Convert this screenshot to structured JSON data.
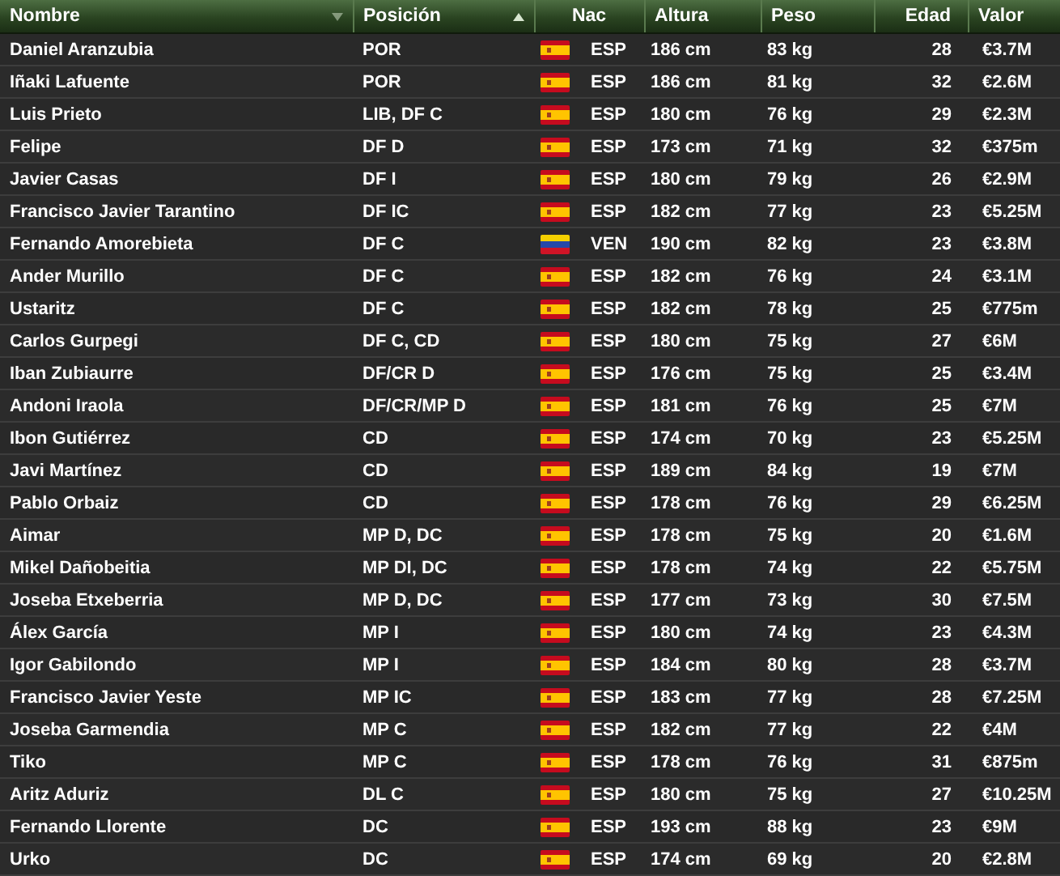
{
  "table": {
    "columns": [
      {
        "label": "Nombre",
        "sort_ascending": false,
        "sort_descending": true
      },
      {
        "label": "Posición",
        "sort_ascending": true,
        "sort_descending": false
      },
      {
        "label": "Nac",
        "sort_ascending": false,
        "sort_descending": false
      },
      {
        "label": "Altura",
        "sort_ascending": false,
        "sort_descending": false
      },
      {
        "label": "Peso",
        "sort_ascending": false,
        "sort_descending": false
      },
      {
        "label": "Edad",
        "sort_ascending": false,
        "sort_descending": false
      },
      {
        "label": "Valor",
        "sort_ascending": false,
        "sort_descending": false
      }
    ],
    "rows": [
      {
        "name": "Daniel Aranzubia",
        "position": "POR",
        "flag": {
          "kind": "spain"
        },
        "nat": "ESP",
        "height": "186 cm",
        "weight": "83 kg",
        "age": "28",
        "value": "€3.7M"
      },
      {
        "name": "Iñaki Lafuente",
        "position": "POR",
        "flag": {
          "kind": "spain"
        },
        "nat": "ESP",
        "height": "186 cm",
        "weight": "81 kg",
        "age": "32",
        "value": "€2.6M"
      },
      {
        "name": "Luis Prieto",
        "position": "LIB, DF C",
        "flag": {
          "kind": "spain"
        },
        "nat": "ESP",
        "height": "180 cm",
        "weight": "76 kg",
        "age": "29",
        "value": "€2.3M"
      },
      {
        "name": "Felipe",
        "position": "DF D",
        "flag": {
          "kind": "spain"
        },
        "nat": "ESP",
        "height": "173 cm",
        "weight": "71 kg",
        "age": "32",
        "value": "€375m"
      },
      {
        "name": "Javier Casas",
        "position": "DF I",
        "flag": {
          "kind": "spain"
        },
        "nat": "ESP",
        "height": "180 cm",
        "weight": "79 kg",
        "age": "26",
        "value": "€2.9M"
      },
      {
        "name": "Francisco Javier Tarantino",
        "position": "DF IC",
        "flag": {
          "kind": "spain"
        },
        "nat": "ESP",
        "height": "182 cm",
        "weight": "77 kg",
        "age": "23",
        "value": "€5.25M"
      },
      {
        "name": "Fernando Amorebieta",
        "position": "DF C",
        "flag": {
          "kind": "venezuela"
        },
        "nat": "VEN",
        "height": "190 cm",
        "weight": "82 kg",
        "age": "23",
        "value": "€3.8M"
      },
      {
        "name": "Ander Murillo",
        "position": "DF C",
        "flag": {
          "kind": "spain"
        },
        "nat": "ESP",
        "height": "182 cm",
        "weight": "76 kg",
        "age": "24",
        "value": "€3.1M"
      },
      {
        "name": "Ustaritz",
        "position": "DF C",
        "flag": {
          "kind": "spain"
        },
        "nat": "ESP",
        "height": "182 cm",
        "weight": "78 kg",
        "age": "25",
        "value": "€775m"
      },
      {
        "name": "Carlos Gurpegi",
        "position": "DF C, CD",
        "flag": {
          "kind": "spain"
        },
        "nat": "ESP",
        "height": "180 cm",
        "weight": "75 kg",
        "age": "27",
        "value": "€6M"
      },
      {
        "name": "Iban Zubiaurre",
        "position": "DF/CR D",
        "flag": {
          "kind": "spain"
        },
        "nat": "ESP",
        "height": "176 cm",
        "weight": "75 kg",
        "age": "25",
        "value": "€3.4M"
      },
      {
        "name": "Andoni Iraola",
        "position": "DF/CR/MP D",
        "flag": {
          "kind": "spain"
        },
        "nat": "ESP",
        "height": "181 cm",
        "weight": "76 kg",
        "age": "25",
        "value": "€7M"
      },
      {
        "name": "Ibon Gutiérrez",
        "position": "CD",
        "flag": {
          "kind": "spain"
        },
        "nat": "ESP",
        "height": "174 cm",
        "weight": "70 kg",
        "age": "23",
        "value": "€5.25M"
      },
      {
        "name": "Javi Martínez",
        "position": "CD",
        "flag": {
          "kind": "spain"
        },
        "nat": "ESP",
        "height": "189 cm",
        "weight": "84 kg",
        "age": "19",
        "value": "€7M"
      },
      {
        "name": "Pablo Orbaiz",
        "position": "CD",
        "flag": {
          "kind": "spain"
        },
        "nat": "ESP",
        "height": "178 cm",
        "weight": "76 kg",
        "age": "29",
        "value": "€6.25M"
      },
      {
        "name": "Aimar",
        "position": "MP D, DC",
        "flag": {
          "kind": "spain"
        },
        "nat": "ESP",
        "height": "178 cm",
        "weight": "75 kg",
        "age": "20",
        "value": "€1.6M"
      },
      {
        "name": "Mikel Dañobeitia",
        "position": "MP DI, DC",
        "flag": {
          "kind": "spain"
        },
        "nat": "ESP",
        "height": "178 cm",
        "weight": "74 kg",
        "age": "22",
        "value": "€5.75M"
      },
      {
        "name": "Joseba Etxeberria",
        "position": "MP D, DC",
        "flag": {
          "kind": "spain"
        },
        "nat": "ESP",
        "height": "177 cm",
        "weight": "73 kg",
        "age": "30",
        "value": "€7.5M"
      },
      {
        "name": "Álex García",
        "position": "MP I",
        "flag": {
          "kind": "spain"
        },
        "nat": "ESP",
        "height": "180 cm",
        "weight": "74 kg",
        "age": "23",
        "value": "€4.3M"
      },
      {
        "name": "Igor Gabilondo",
        "position": "MP I",
        "flag": {
          "kind": "spain"
        },
        "nat": "ESP",
        "height": "184 cm",
        "weight": "80 kg",
        "age": "28",
        "value": "€3.7M"
      },
      {
        "name": "Francisco Javier Yeste",
        "position": "MP IC",
        "flag": {
          "kind": "spain"
        },
        "nat": "ESP",
        "height": "183 cm",
        "weight": "77 kg",
        "age": "28",
        "value": "€7.25M"
      },
      {
        "name": "Joseba Garmendia",
        "position": "MP C",
        "flag": {
          "kind": "spain"
        },
        "nat": "ESP",
        "height": "182 cm",
        "weight": "77 kg",
        "age": "22",
        "value": "€4M"
      },
      {
        "name": "Tiko",
        "position": "MP C",
        "flag": {
          "kind": "spain"
        },
        "nat": "ESP",
        "height": "178 cm",
        "weight": "76 kg",
        "age": "31",
        "value": "€875m"
      },
      {
        "name": "Aritz Aduriz",
        "position": "DL C",
        "flag": {
          "kind": "spain"
        },
        "nat": "ESP",
        "height": "180 cm",
        "weight": "75 kg",
        "age": "27",
        "value": "€10.25M"
      },
      {
        "name": "Fernando Llorente",
        "position": "DC",
        "flag": {
          "kind": "spain"
        },
        "nat": "ESP",
        "height": "193 cm",
        "weight": "88 kg",
        "age": "23",
        "value": "€9M"
      },
      {
        "name": "Urko",
        "position": "DC",
        "flag": {
          "kind": "spain"
        },
        "nat": "ESP",
        "height": "174 cm",
        "weight": "69 kg",
        "age": "20",
        "value": "€2.8M"
      }
    ]
  }
}
